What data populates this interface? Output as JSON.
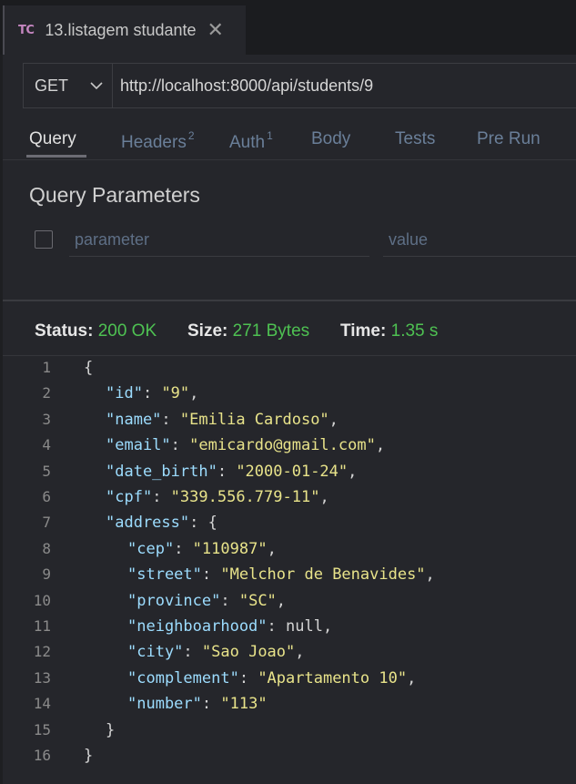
{
  "tab": {
    "badge": "TC",
    "title": "13.listagem studante",
    "close_icon": "close-icon"
  },
  "request": {
    "method": "GET",
    "url": "http://localhost:8000/api/students/9"
  },
  "request_tabs": [
    {
      "label": "Query",
      "count": ""
    },
    {
      "label": "Headers",
      "count": "2"
    },
    {
      "label": "Auth",
      "count": "1"
    },
    {
      "label": "Body",
      "count": ""
    },
    {
      "label": "Tests",
      "count": ""
    },
    {
      "label": "Pre Run",
      "count": ""
    }
  ],
  "query_params": {
    "title": "Query Parameters",
    "param_placeholder": "parameter",
    "value_placeholder": "value"
  },
  "response": {
    "status_label": "Status:",
    "status_value": "200 OK",
    "size_label": "Size:",
    "size_value": "271 Bytes",
    "time_label": "Time:",
    "time_value": "1.35 s"
  },
  "code_lines": [
    {
      "n": "1",
      "indent": 0,
      "open": "{"
    },
    {
      "n": "2",
      "indent": 1,
      "key": "\"id\"",
      "value": "\"9\"",
      "type": "str",
      "comma": true
    },
    {
      "n": "3",
      "indent": 1,
      "key": "\"name\"",
      "value": "\"Emilia Cardoso\"",
      "type": "str",
      "comma": true
    },
    {
      "n": "4",
      "indent": 1,
      "key": "\"email\"",
      "value": "\"emicardo@gmail.com\"",
      "type": "str",
      "comma": true
    },
    {
      "n": "5",
      "indent": 1,
      "key": "\"date_birth\"",
      "value": "\"2000-01-24\"",
      "type": "str",
      "comma": true
    },
    {
      "n": "6",
      "indent": 1,
      "key": "\"cpf\"",
      "value": "\"339.556.779-11\"",
      "type": "str",
      "comma": true
    },
    {
      "n": "7",
      "indent": 1,
      "key": "\"address\"",
      "value": "{",
      "type": "pun",
      "comma": false
    },
    {
      "n": "8",
      "indent": 2,
      "key": "\"cep\"",
      "value": "\"110987\"",
      "type": "str",
      "comma": true
    },
    {
      "n": "9",
      "indent": 2,
      "key": "\"street\"",
      "value": "\"Melchor de Benavides\"",
      "type": "str",
      "comma": true
    },
    {
      "n": "10",
      "indent": 2,
      "key": "\"province\"",
      "value": "\"SC\"",
      "type": "str",
      "comma": true
    },
    {
      "n": "11",
      "indent": 2,
      "key": "\"neighboarhood\"",
      "value": "null",
      "type": "nul",
      "comma": true
    },
    {
      "n": "12",
      "indent": 2,
      "key": "\"city\"",
      "value": "\"Sao Joao\"",
      "type": "str",
      "comma": true
    },
    {
      "n": "13",
      "indent": 2,
      "key": "\"complement\"",
      "value": "\"Apartamento 10\"",
      "type": "str",
      "comma": true
    },
    {
      "n": "14",
      "indent": 2,
      "key": "\"number\"",
      "value": "\"113\"",
      "type": "str",
      "comma": false
    },
    {
      "n": "15",
      "indent": 1,
      "open": "}"
    },
    {
      "n": "16",
      "indent": 0,
      "open": "}"
    }
  ]
}
